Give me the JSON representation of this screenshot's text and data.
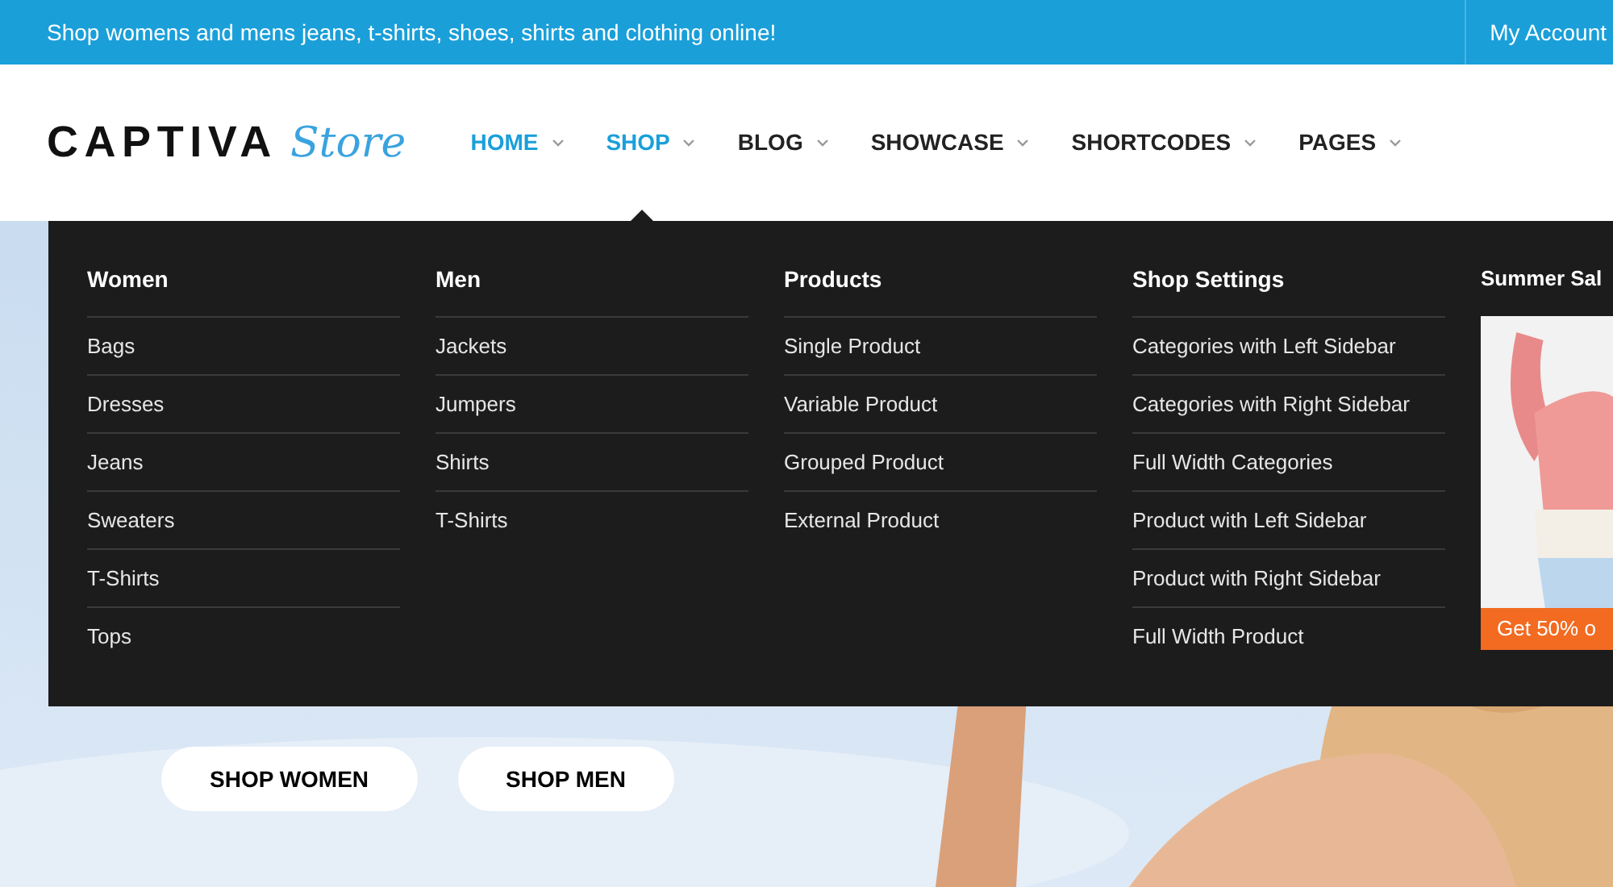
{
  "top_bar": {
    "tagline": "Shop womens and mens jeans, t-shirts, shoes, shirts and clothing online!",
    "account_link": "My Account"
  },
  "logo": {
    "wordmark": "CAPTIVA",
    "script": "Store"
  },
  "nav": [
    {
      "label": "HOME",
      "highlighted": true,
      "open": false
    },
    {
      "label": "SHOP",
      "highlighted": true,
      "open": true
    },
    {
      "label": "BLOG",
      "highlighted": false,
      "open": false
    },
    {
      "label": "SHOWCASE",
      "highlighted": false,
      "open": false
    },
    {
      "label": "SHORTCODES",
      "highlighted": false,
      "open": false
    },
    {
      "label": "PAGES",
      "highlighted": false,
      "open": false
    }
  ],
  "mega_menu": {
    "columns": [
      {
        "kind": "links",
        "title": "Women",
        "items": [
          "Bags",
          "Dresses",
          "Jeans",
          "Sweaters",
          "T-Shirts",
          "Tops"
        ]
      },
      {
        "kind": "links",
        "title": "Men",
        "items": [
          "Jackets",
          "Jumpers",
          "Shirts",
          "T-Shirts"
        ]
      },
      {
        "kind": "links",
        "title": "Products",
        "items": [
          "Single Product",
          "Variable Product",
          "Grouped Product",
          "External Product"
        ]
      },
      {
        "kind": "links",
        "title": "Shop Settings",
        "items": [
          "Categories with Left Sidebar",
          "Categories with Right Sidebar",
          "Full Width Categories",
          "Product with Left Sidebar",
          "Product with Right Sidebar",
          "Full Width Product"
        ]
      },
      {
        "kind": "promo",
        "title": "Summer Sal",
        "banner": "Get 50% o"
      }
    ]
  },
  "hero": {
    "buttons": [
      "SHOP WOMEN",
      "SHOP MEN"
    ]
  }
}
